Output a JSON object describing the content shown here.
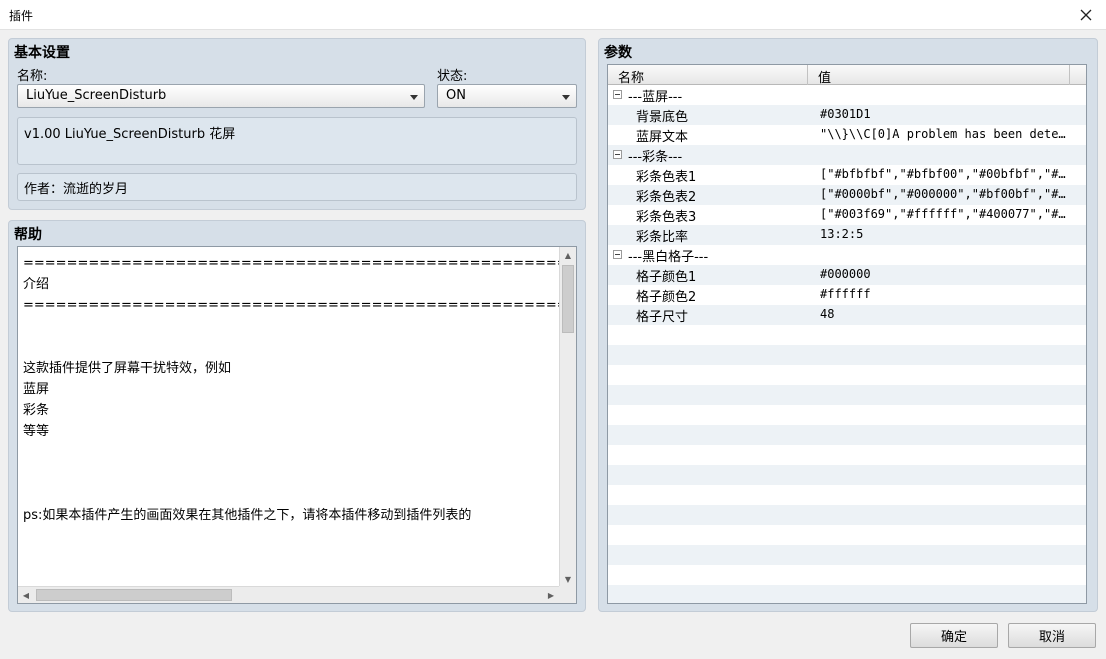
{
  "window": {
    "title": "插件"
  },
  "basic": {
    "title": "基本设置",
    "name_label": "名称:",
    "name_value": "LiuYue_ScreenDisturb",
    "status_label": "状态:",
    "status_value": "ON",
    "description": "v1.00 LiuYue_ScreenDisturb 花屏",
    "author": "作者：流逝的岁月"
  },
  "help": {
    "title": "帮助",
    "text": "==========================================================================\n介绍\n========================================================================== *\n\n\n这款插件提供了屏幕干扰特效，例如\n蓝屏\n彩条\n等等\n\n\n\nps:如果本插件产生的画面效果在其他插件之下，请将本插件移动到插件列表的"
  },
  "params": {
    "title": "参数",
    "col_name": "名称",
    "col_value": "值",
    "rows": [
      {
        "type": "group",
        "name": "---蓝屏---",
        "value": ""
      },
      {
        "type": "item",
        "name": "背景底色",
        "value": "#0301D1"
      },
      {
        "type": "item",
        "name": "蓝屏文本",
        "value": "\"\\\\}\\\\C[0]A problem has been detec…"
      },
      {
        "type": "group",
        "name": "---彩条---",
        "value": ""
      },
      {
        "type": "item",
        "name": "彩条色表1",
        "value": "[\"#bfbfbf\",\"#bfbf00\",\"#00bfbf\",\"#0…"
      },
      {
        "type": "item",
        "name": "彩条色表2",
        "value": "[\"#0000bf\",\"#000000\",\"#bf00bf\",\"#0…"
      },
      {
        "type": "item",
        "name": "彩条色表3",
        "value": "[\"#003f69\",\"#ffffff\",\"#400077\",\"#0…"
      },
      {
        "type": "item",
        "name": "彩条比率",
        "value": "13:2:5"
      },
      {
        "type": "group",
        "name": "---黑白格子---",
        "value": ""
      },
      {
        "type": "item",
        "name": "格子颜色1",
        "value": "#000000"
      },
      {
        "type": "item",
        "name": "格子颜色2",
        "value": "#ffffff"
      },
      {
        "type": "item",
        "name": "格子尺寸",
        "value": "48"
      }
    ]
  },
  "buttons": {
    "ok": "确定",
    "cancel": "取消"
  },
  "icons": {
    "close": "close-icon",
    "dropdown": "chevron-down-icon",
    "collapse": "minus-box-icon"
  }
}
